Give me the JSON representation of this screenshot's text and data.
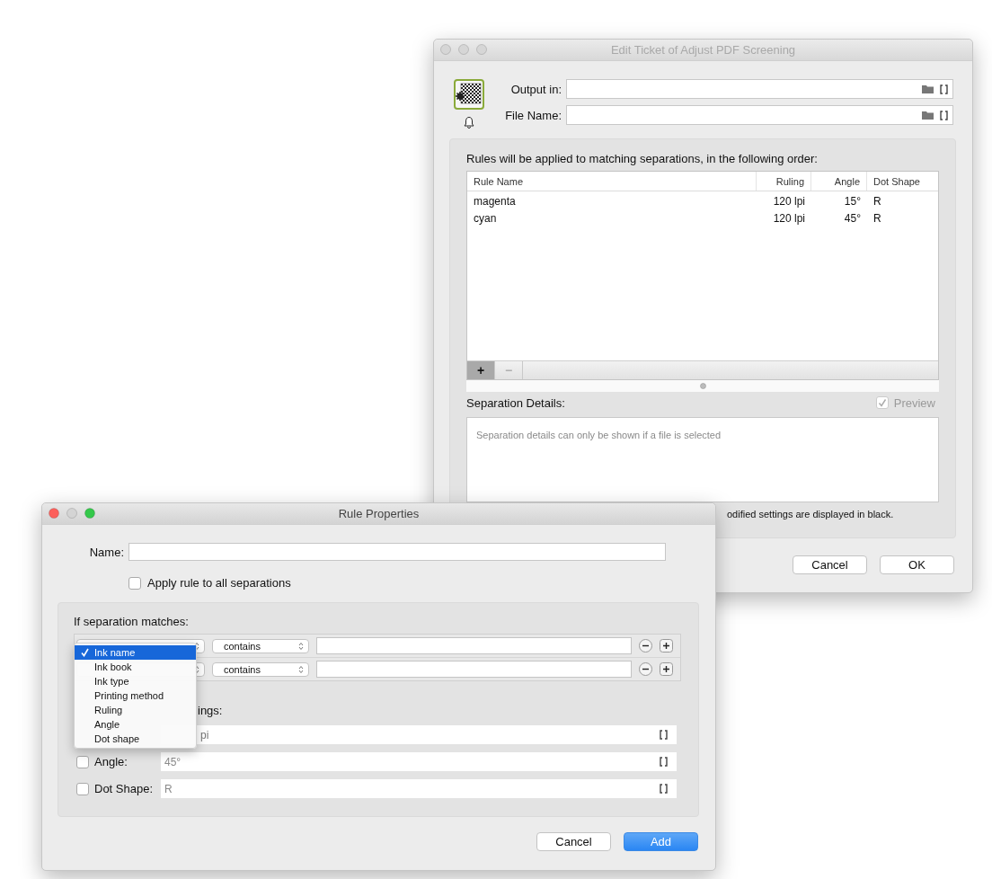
{
  "ticket_window": {
    "title": "Edit Ticket of Adjust PDF Screening",
    "fields": [
      {
        "label": "Output in:"
      },
      {
        "label": "File Name:"
      }
    ],
    "rules_heading": "Rules will be applied to matching separations, in the following order:",
    "table": {
      "columns": [
        "Rule Name",
        "Ruling",
        "Angle",
        "Dot Shape"
      ],
      "rows": [
        {
          "cells": [
            "magenta",
            "120 lpi",
            "15°",
            "R"
          ],
          "selected": false
        },
        {
          "cells": [
            "cyan",
            "120 lpi",
            "45°",
            "R"
          ],
          "selected": false
        }
      ]
    },
    "toolbar": [
      {
        "label": "+",
        "disabled": false
      },
      {
        "label": "−",
        "disabled": true
      }
    ],
    "details_label": "Separation Details:",
    "preview": {
      "label": "Preview",
      "checked": true,
      "disabled": true
    },
    "details_text": "Separation details can only be shown if a file is selected",
    "note": "odified settings are displayed in black.",
    "buttons": [
      {
        "label": "Cancel",
        "default": false
      },
      {
        "label": "OK",
        "default": false
      }
    ]
  },
  "rule_window": {
    "title": "Rule Properties",
    "name_label": "Name:",
    "apply_all": {
      "label": "Apply rule to all separations",
      "checked": false
    },
    "conditions_label": "If separation matches:",
    "conditions": [
      {
        "operator": "contains"
      },
      {
        "operator": "contains"
      }
    ],
    "settings_label": "ings:",
    "settings": [
      {
        "kind": "covered",
        "value": "pi"
      },
      {
        "kind": "full",
        "label": "Angle:",
        "value": "45°",
        "checked": false
      },
      {
        "kind": "full",
        "label": "Dot Shape:",
        "value": "R",
        "checked": false
      }
    ],
    "buttons": [
      {
        "label": "Cancel",
        "default": false
      },
      {
        "label": "Add",
        "default": true
      }
    ],
    "menu": [
      {
        "label": "Ink name",
        "selected": true
      },
      {
        "label": "Ink book",
        "selected": false
      },
      {
        "label": "Ink type",
        "selected": false
      },
      {
        "label": "Printing method",
        "selected": false
      },
      {
        "label": "Ruling",
        "selected": false
      },
      {
        "label": "Angle",
        "selected": false
      },
      {
        "label": "Dot shape",
        "selected": false
      }
    ]
  }
}
